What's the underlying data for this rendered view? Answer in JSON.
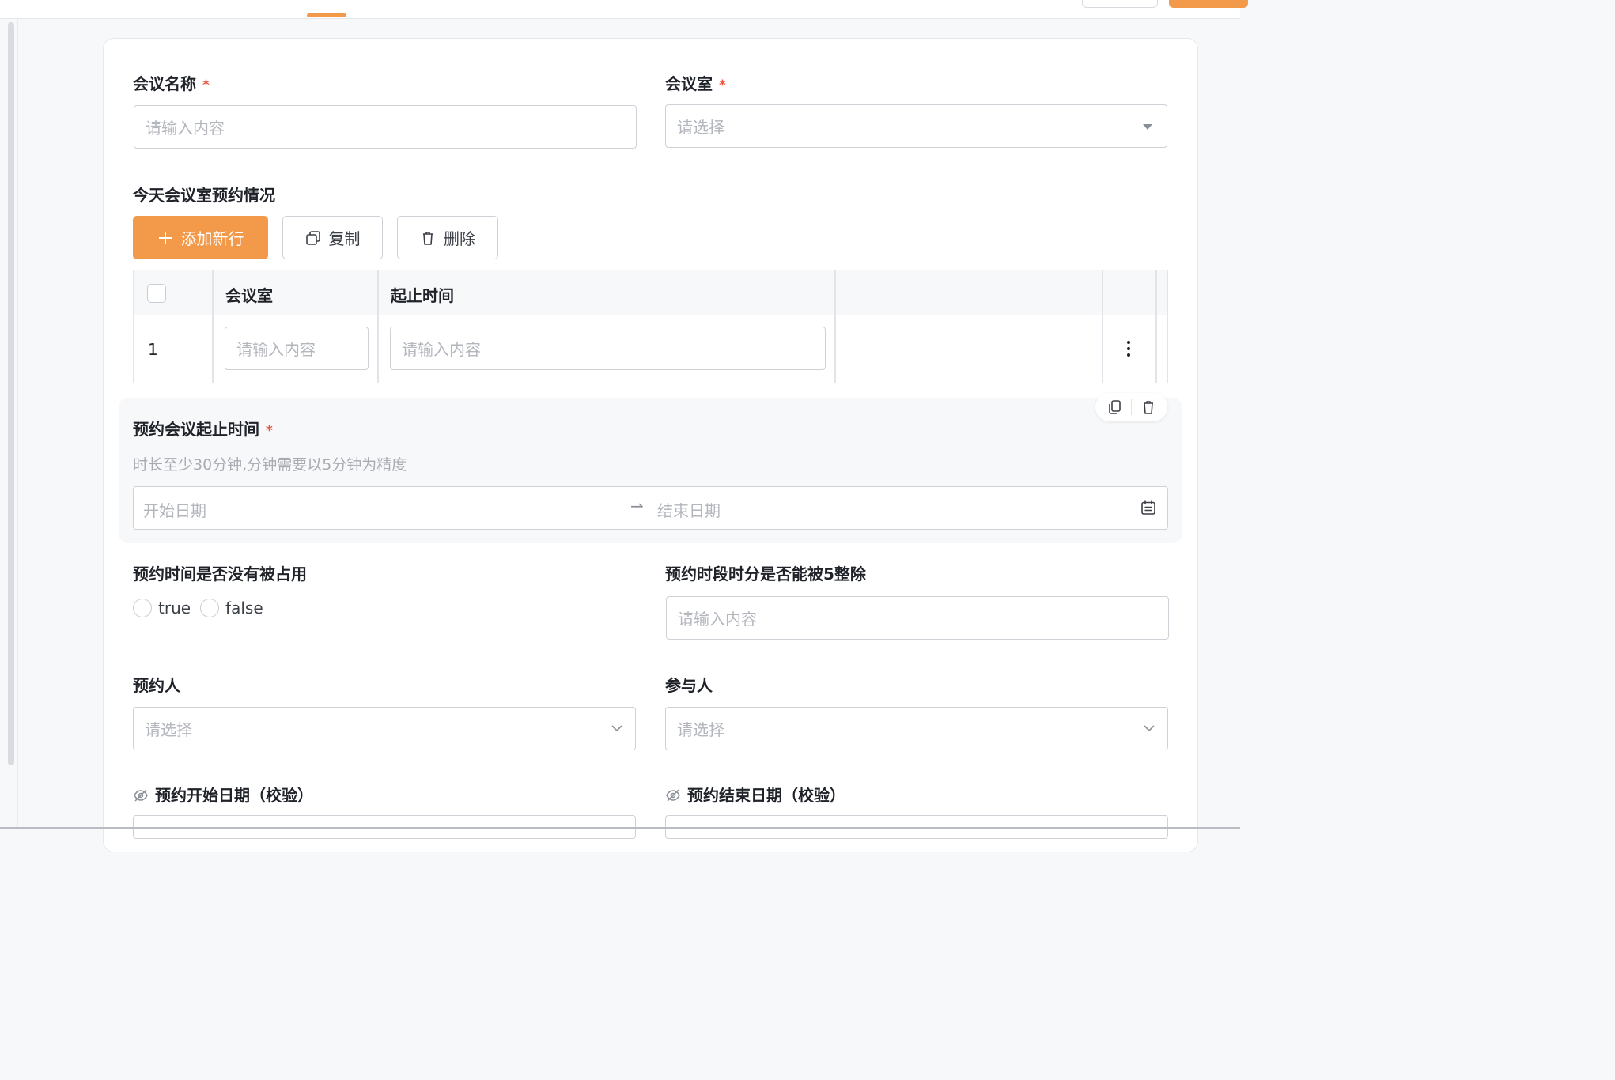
{
  "form": {
    "meeting_name": {
      "label": "会议名称",
      "required": "*",
      "placeholder": "请输入内容"
    },
    "meeting_room": {
      "label": "会议室",
      "required": "*",
      "placeholder": "请选择"
    },
    "today_bookings": {
      "label": "今天会议室预约情况",
      "buttons": {
        "add": "添加新行",
        "copy": "复制",
        "delete": "删除"
      },
      "table": {
        "columns": [
          "会议室",
          "起止时间"
        ],
        "rows": [
          {
            "index": "1",
            "room_placeholder": "请输入内容",
            "time_placeholder": "请输入内容"
          }
        ]
      }
    },
    "booking_time": {
      "label": "预约会议起止时间",
      "required": "*",
      "hint": "时长至少30分钟,分钟需要以5分钟为精度",
      "start_placeholder": "开始日期",
      "separator": "⇀",
      "end_placeholder": "结束日期"
    },
    "not_occupied": {
      "label": "预约时间是否没有被占用",
      "options": [
        "true",
        "false"
      ]
    },
    "divisible_by_5": {
      "label": "预约时段时分是否能被5整除",
      "placeholder": "请输入内容"
    },
    "booker": {
      "label": "预约人",
      "placeholder": "请选择"
    },
    "participants": {
      "label": "参与人",
      "placeholder": "请选择"
    },
    "start_date_check": {
      "label": "预约开始日期（校验）"
    },
    "end_date_check": {
      "label": "预约结束日期（校验）"
    }
  },
  "colors": {
    "accent": "#f29a4a",
    "required": "#e8553f",
    "placeholder": "#b3b6bd"
  },
  "icons": [
    "plus-icon",
    "copy-icon",
    "trash-icon",
    "kebab-icon",
    "calendar-icon",
    "chevron-down-icon",
    "eye-off-icon"
  ]
}
